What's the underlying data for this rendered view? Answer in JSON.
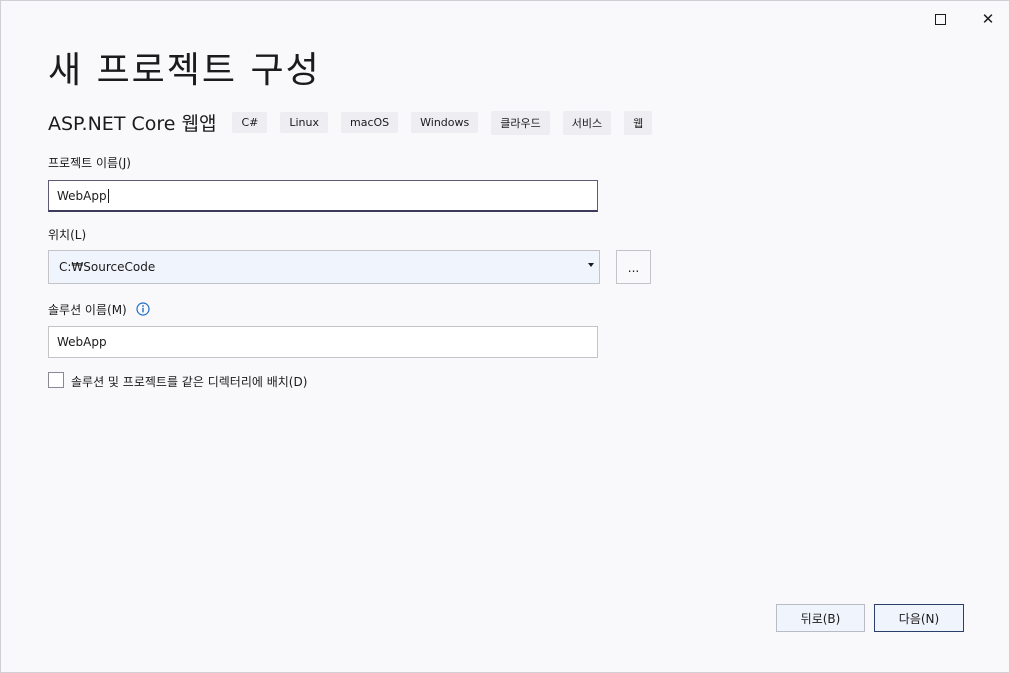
{
  "window": {
    "maximize_icon": "maximize-icon",
    "close_icon": "close-icon",
    "close_glyph": "✕"
  },
  "header": {
    "title": "새 프로젝트 구성",
    "template_name": "ASP.NET Core 웹앱",
    "tags": [
      "C#",
      "Linux",
      "macOS",
      "Windows",
      "클라우드",
      "서비스",
      "웹"
    ]
  },
  "form": {
    "project_name_label": "프로젝트 이름(J)",
    "project_name_value": "WebApp",
    "location_label": "위치(L)",
    "location_value": "C:₩SourceCode",
    "browse_label": "...",
    "solution_name_label": "솔루션 이름(M)",
    "solution_name_value": "WebApp",
    "same_dir_label": "솔루션 및 프로젝트를 같은 디렉터리에 배치(D)",
    "same_dir_checked": false
  },
  "footer": {
    "back_label": "뒤로(B)",
    "next_label": "다음(N)"
  },
  "colors": {
    "background": "#f9f9fb",
    "info_icon": "#1e6ec8",
    "input_border": "#c3c3c8",
    "accent_border": "#2c3e6b"
  }
}
